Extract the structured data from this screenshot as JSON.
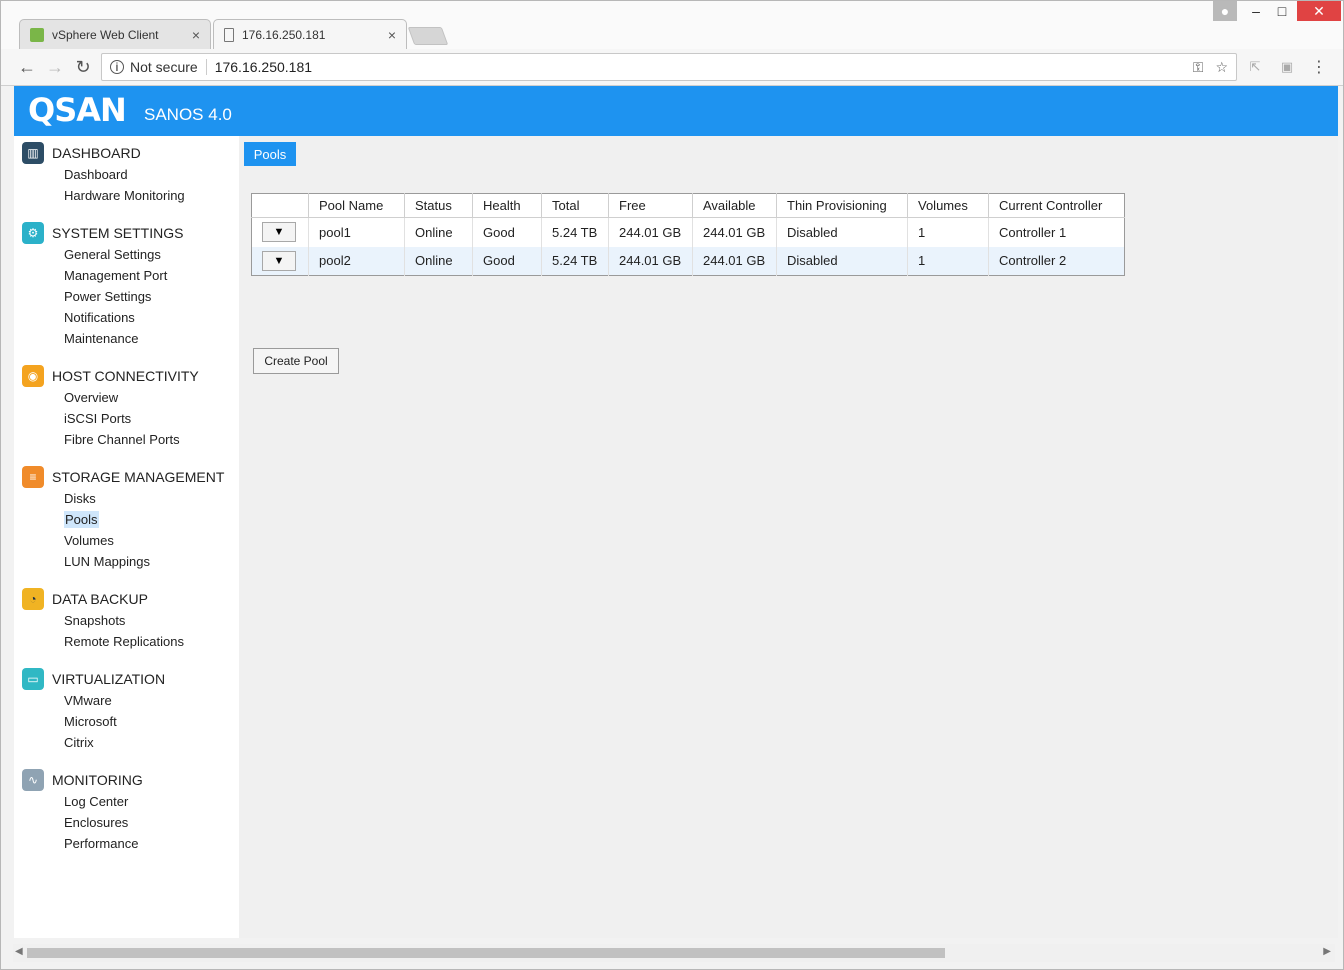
{
  "browser": {
    "tabs": [
      {
        "title": "vSphere Web Client",
        "close": "×"
      },
      {
        "title": "176.16.250.181",
        "close": "×"
      }
    ],
    "security_label": "Not secure",
    "url": "176.16.250.181",
    "window_controls": {
      "minimize": "–",
      "maximize": "□",
      "close": "✕"
    }
  },
  "app": {
    "logo": "QSAN",
    "product": "SANOS 4.0",
    "accent": "#1e93f0"
  },
  "sidebar": {
    "sections": [
      {
        "title": "DASHBOARD",
        "icon": "dashboard-icon",
        "items": [
          "Dashboard",
          "Hardware Monitoring"
        ]
      },
      {
        "title": "SYSTEM SETTINGS",
        "icon": "system-settings-icon",
        "items": [
          "General Settings",
          "Management Port",
          "Power Settings",
          "Notifications",
          "Maintenance"
        ]
      },
      {
        "title": "HOST CONNECTIVITY",
        "icon": "host-connectivity-icon",
        "items": [
          "Overview",
          "iSCSI Ports",
          "Fibre Channel Ports"
        ]
      },
      {
        "title": "STORAGE MANAGEMENT",
        "icon": "storage-management-icon",
        "items": [
          "Disks",
          "Pools",
          "Volumes",
          "LUN Mappings"
        ]
      },
      {
        "title": "DATA BACKUP",
        "icon": "data-backup-icon",
        "items": [
          "Snapshots",
          "Remote Replications"
        ]
      },
      {
        "title": "VIRTUALIZATION",
        "icon": "virtualization-icon",
        "items": [
          "VMware",
          "Microsoft",
          "Citrix"
        ]
      },
      {
        "title": "MONITORING",
        "icon": "monitoring-icon",
        "items": [
          "Log Center",
          "Enclosures",
          "Performance"
        ]
      }
    ],
    "active_item": "Pools"
  },
  "content": {
    "page_tab": "Pools",
    "table": {
      "headers": [
        "",
        "Pool Name",
        "Status",
        "Health",
        "Total",
        "Free",
        "Available",
        "Thin Provisioning",
        "Volumes",
        "Current Controller"
      ],
      "rows": [
        {
          "menu": "▼",
          "name": "pool1",
          "status": "Online",
          "health": "Good",
          "total": "5.24 TB",
          "free": "244.01 GB",
          "available": "244.01 GB",
          "thin": "Disabled",
          "volumes": "1",
          "controller": "Controller 1"
        },
        {
          "menu": "▼",
          "name": "pool2",
          "status": "Online",
          "health": "Good",
          "total": "5.24 TB",
          "free": "244.01 GB",
          "available": "244.01 GB",
          "thin": "Disabled",
          "volumes": "1",
          "controller": "Controller 2"
        }
      ]
    },
    "create_button": "Create Pool"
  }
}
